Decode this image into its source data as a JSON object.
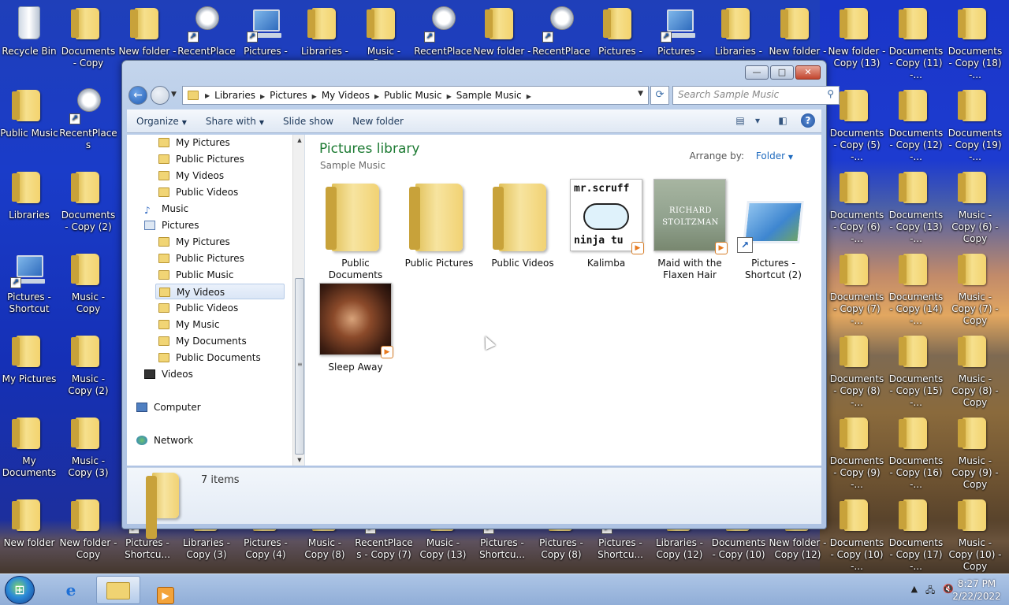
{
  "desktop": {
    "icons": [
      {
        "label": "Recycle Bin",
        "type": "bin"
      },
      {
        "label": "Documents - Copy",
        "type": "folder"
      },
      {
        "label": "New folder -",
        "type": "folder"
      },
      {
        "label": "RecentPlaces",
        "type": "recent"
      },
      {
        "label": "Pictures -",
        "type": "monitor"
      },
      {
        "label": "Libraries -",
        "type": "folder"
      },
      {
        "label": "Music - Copy",
        "type": "folder"
      },
      {
        "label": "RecentPlaces",
        "type": "recent"
      },
      {
        "label": "New folder -",
        "type": "folder"
      },
      {
        "label": "RecentPlaces",
        "type": "recent"
      },
      {
        "label": "Pictures -",
        "type": "folder"
      },
      {
        "label": "Pictures -",
        "type": "monitor"
      },
      {
        "label": "Libraries -",
        "type": "folder"
      },
      {
        "label": "New folder -",
        "type": "folder"
      },
      {
        "label": "New folder - Copy (13)",
        "type": "folder"
      },
      {
        "label": "Documents - Copy (11) -...",
        "type": "folder"
      },
      {
        "label": "Documents - Copy (18) -...",
        "type": "folder"
      },
      {
        "label": "Public Music",
        "type": "folder"
      },
      {
        "label": "RecentPlaces",
        "type": "recent"
      },
      {
        "label": "Documents - Copy (5) -...",
        "type": "folder"
      },
      {
        "label": "Documents - Copy (12) -...",
        "type": "folder"
      },
      {
        "label": "Documents - Copy (19) -...",
        "type": "folder"
      },
      {
        "label": "Libraries",
        "type": "folder"
      },
      {
        "label": "Documents - Copy (2)",
        "type": "folder"
      },
      {
        "label": "Documents - Copy (6) -...",
        "type": "folder"
      },
      {
        "label": "Documents - Copy (13) -...",
        "type": "folder"
      },
      {
        "label": "Music - Copy (6) - Copy",
        "type": "folder"
      },
      {
        "label": "Pictures - Shortcut",
        "type": "monitor"
      },
      {
        "label": "Music - Copy",
        "type": "folder"
      },
      {
        "label": "Documents - Copy (7) -...",
        "type": "folder"
      },
      {
        "label": "Documents - Copy (14) -...",
        "type": "folder"
      },
      {
        "label": "Music - Copy (7) - Copy",
        "type": "folder"
      },
      {
        "label": "My Pictures",
        "type": "folder"
      },
      {
        "label": "Music - Copy (2)",
        "type": "folder"
      },
      {
        "label": "Documents - Copy (8) -...",
        "type": "folder"
      },
      {
        "label": "Documents - Copy (15) -...",
        "type": "folder"
      },
      {
        "label": "Music - Copy (8) - Copy",
        "type": "folder"
      },
      {
        "label": "My Documents",
        "type": "folder"
      },
      {
        "label": "Music - Copy (3)",
        "type": "folder"
      },
      {
        "label": "Documents - Copy (9) -...",
        "type": "folder"
      },
      {
        "label": "Documents - Copy (16) -...",
        "type": "folder"
      },
      {
        "label": "Music - Copy (9) - Copy",
        "type": "folder"
      },
      {
        "label": "New folder",
        "type": "folder"
      },
      {
        "label": "New folder - Copy",
        "type": "folder"
      },
      {
        "label": "Pictures - Shortcu...",
        "type": "monitor"
      },
      {
        "label": "Libraries - Copy (3)",
        "type": "folder"
      },
      {
        "label": "Pictures - Copy (4)",
        "type": "folder"
      },
      {
        "label": "Music - Copy (8)",
        "type": "folder"
      },
      {
        "label": "RecentPlaces - Copy (7)",
        "type": "recent"
      },
      {
        "label": "Music - Copy (13)",
        "type": "folder"
      },
      {
        "label": "Pictures - Shortcu...",
        "type": "monitor"
      },
      {
        "label": "Pictures - Copy (8)",
        "type": "folder"
      },
      {
        "label": "Pictures - Shortcu...",
        "type": "monitor"
      },
      {
        "label": "Libraries - Copy (12)",
        "type": "folder"
      },
      {
        "label": "Documents - Copy (10)",
        "type": "folder"
      },
      {
        "label": "New folder - Copy (12)",
        "type": "folder"
      },
      {
        "label": "Documents - Copy (10) -...",
        "type": "folder"
      },
      {
        "label": "Documents - Copy (17) -...",
        "type": "folder"
      },
      {
        "label": "Music - Copy (10) - Copy",
        "type": "folder"
      }
    ]
  },
  "window": {
    "buttons": {
      "minimize": "—",
      "maximize": "□",
      "close": "✕"
    },
    "back_glyph": "←",
    "breadcrumb": [
      "Libraries",
      "Pictures",
      "My Videos",
      "Public Music",
      "Sample Music"
    ],
    "search_placeholder": "Search Sample Music",
    "toolbar": {
      "organize": "Organize",
      "share_with": "Share with",
      "slide_show": "Slide show",
      "new_folder": "New folder"
    },
    "nav_tree": [
      {
        "label": "My Pictures",
        "icon": "folder",
        "indent": 2
      },
      {
        "label": "Public Pictures",
        "icon": "folder",
        "indent": 2
      },
      {
        "label": "My Videos",
        "icon": "folder",
        "indent": 2
      },
      {
        "label": "Public Videos",
        "icon": "folder",
        "indent": 2
      },
      {
        "label": "Music",
        "icon": "music",
        "indent": 1
      },
      {
        "label": "Pictures",
        "icon": "pict",
        "indent": 1
      },
      {
        "label": "My Pictures",
        "icon": "folder",
        "indent": 2
      },
      {
        "label": "Public Pictures",
        "icon": "folder",
        "indent": 2
      },
      {
        "label": "Public Music",
        "icon": "folder",
        "indent": 2
      },
      {
        "label": "My Videos",
        "icon": "folder",
        "indent": 2,
        "selected": true
      },
      {
        "label": "Public Videos",
        "icon": "folder",
        "indent": 2
      },
      {
        "label": "My Music",
        "icon": "folder",
        "indent": 2
      },
      {
        "label": "My Documents",
        "icon": "folder",
        "indent": 2
      },
      {
        "label": "Public Documents",
        "icon": "folder",
        "indent": 2
      },
      {
        "label": "Videos",
        "icon": "video",
        "indent": 1
      },
      {
        "label": "",
        "icon": "",
        "indent": 0
      },
      {
        "label": "Computer",
        "icon": "comp",
        "indent": 0
      },
      {
        "label": "",
        "icon": "",
        "indent": 0
      },
      {
        "label": "Network",
        "icon": "net",
        "indent": 0
      }
    ],
    "library_title": "Pictures library",
    "library_subtitle": "Sample Music",
    "arrange_label": "Arrange by:",
    "arrange_value": "Folder",
    "files": [
      {
        "label": "Public Documents",
        "kind": "folder"
      },
      {
        "label": "Public Pictures",
        "kind": "folder"
      },
      {
        "label": "Public Videos",
        "kind": "folder"
      },
      {
        "label": "Kalimba",
        "kind": "album-kalimba",
        "art_text_1": "mr.scruff",
        "art_text_2": "ninja tu"
      },
      {
        "label": "Maid with the Flaxen Hair",
        "kind": "album-maid",
        "art_text_1": "RICHARD STOLTZMAN"
      },
      {
        "label": "Pictures - Shortcut (2)",
        "kind": "shortcut"
      },
      {
        "label": "Sleep Away",
        "kind": "album-sleep"
      }
    ],
    "details_count": "7 items"
  },
  "taskbar": {
    "clock_time": "8:27 PM",
    "clock_date": "2/22/2022"
  }
}
